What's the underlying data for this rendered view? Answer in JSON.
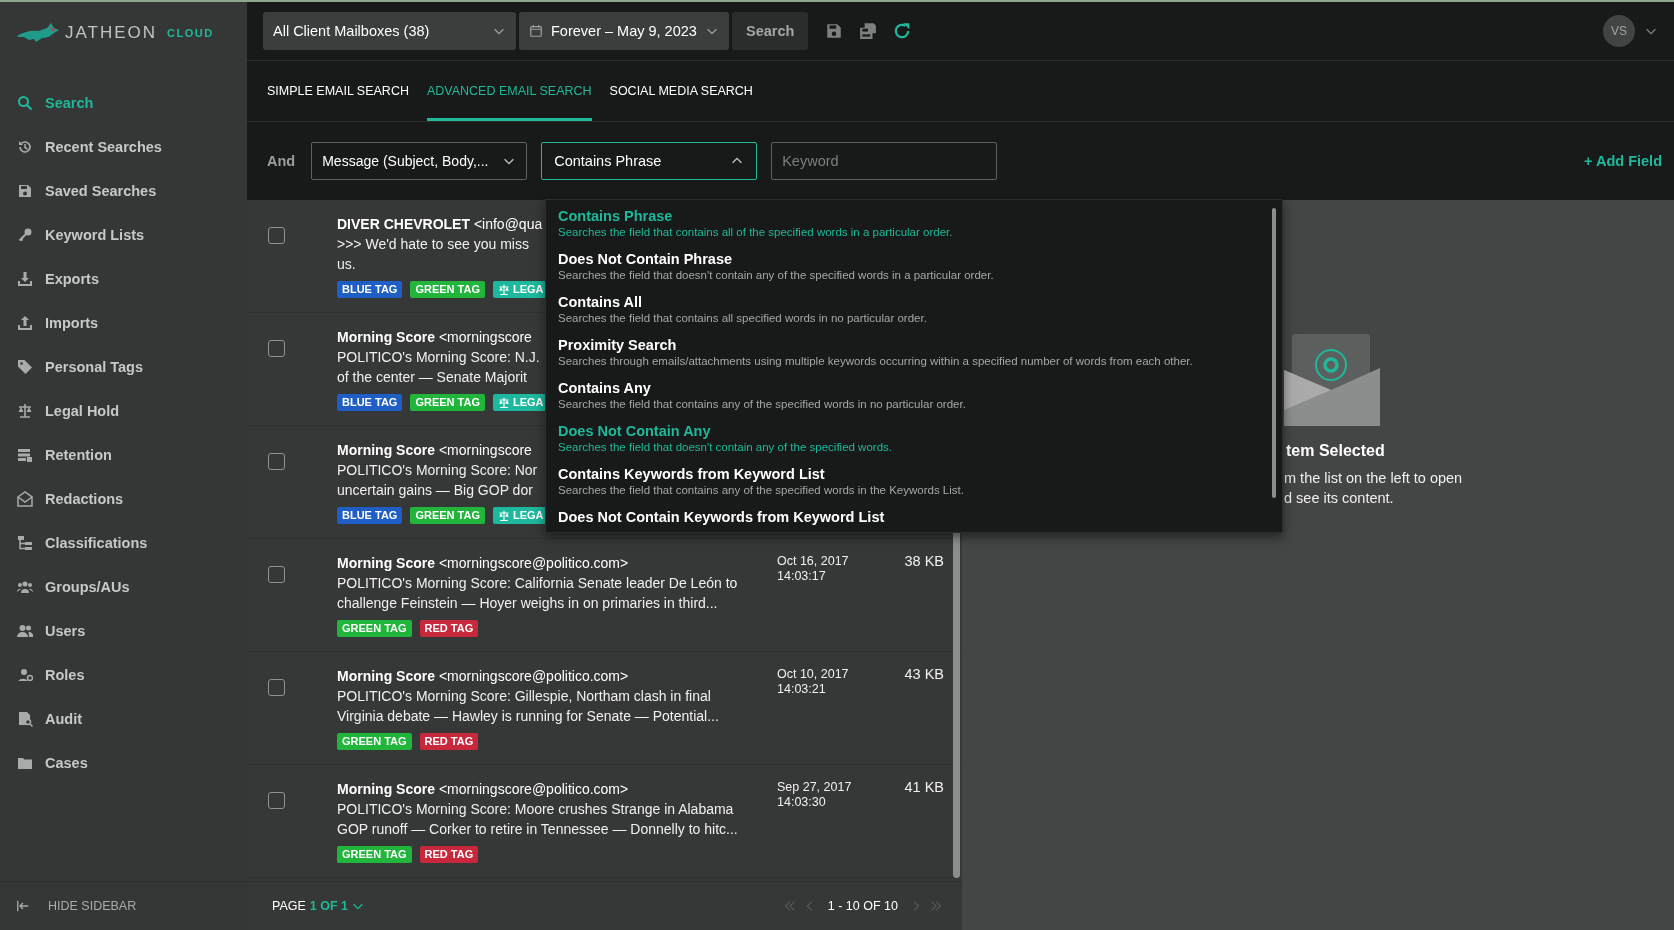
{
  "brand": {
    "name": "JATHEON",
    "suffix": "CLOUD"
  },
  "sidebar": {
    "items": [
      {
        "label": "Search",
        "selected": true
      },
      {
        "label": "Recent Searches",
        "selected": false
      },
      {
        "label": "Saved Searches",
        "selected": false
      },
      {
        "label": "Keyword Lists",
        "selected": false
      },
      {
        "label": "Exports",
        "selected": false
      },
      {
        "label": "Imports",
        "selected": false
      },
      {
        "label": "Personal Tags",
        "selected": false
      },
      {
        "label": "Legal Hold",
        "selected": false
      },
      {
        "label": "Retention",
        "selected": false
      },
      {
        "label": "Redactions",
        "selected": false
      },
      {
        "label": "Classifications",
        "selected": false
      },
      {
        "label": "Groups/AUs",
        "selected": false
      },
      {
        "label": "Users",
        "selected": false
      },
      {
        "label": "Roles",
        "selected": false
      },
      {
        "label": "Audit",
        "selected": false
      },
      {
        "label": "Cases",
        "selected": false
      }
    ],
    "hide_label": "HIDE SIDEBAR"
  },
  "topbar": {
    "mailbox_select": "All Client Mailboxes (38)",
    "date_range": "Forever – May 9, 2023",
    "search_button": "Search",
    "avatar": "VS"
  },
  "tabs": [
    {
      "label": "SIMPLE EMAIL SEARCH",
      "selected": false
    },
    {
      "label": "ADVANCED EMAIL SEARCH",
      "selected": true
    },
    {
      "label": "SOCIAL MEDIA SEARCH",
      "selected": false
    }
  ],
  "query": {
    "operator": "And",
    "field": "Message (Subject, Body,...",
    "condition": "Contains Phrase",
    "condition_expanded": true,
    "keyword_placeholder": "Keyword",
    "add_field": "+ Add Field"
  },
  "condition_menu": [
    {
      "title": "Contains Phrase",
      "description": "Searches the field that contains all of the specified words in a particular order.",
      "highlighted": true
    },
    {
      "title": "Does Not Contain Phrase",
      "description": "Searches the field that doesn't contain any of the specified words in a particular order.",
      "highlighted": false
    },
    {
      "title": "Contains All",
      "description": "Searches the field that contains all specified words in no particular order.",
      "highlighted": false
    },
    {
      "title": "Proximity Search",
      "description": "Searches through emails/attachments using multiple keywords occurring within a specified number of words from each other.",
      "highlighted": false
    },
    {
      "title": "Contains Any",
      "description": "Searches the field that contains any of the specified words in no particular order.",
      "highlighted": false
    },
    {
      "title": "Does Not Contain Any",
      "description": "Searches the field that doesn't contain any of the specified words.",
      "highlighted": true
    },
    {
      "title": "Contains Keywords from Keyword List",
      "description": "Searches the field that contains any of the specified words in the Keywords List.",
      "highlighted": false
    },
    {
      "title": "Does Not Contain Keywords from Keyword List",
      "highlighted": false
    }
  ],
  "emails": [
    {
      "sender": "DIVER CHEVROLET",
      "address": "<info@qua",
      "lines": [
        ">>> We'd hate to see you miss",
        "us."
      ],
      "checked": false,
      "tags": [
        {
          "label": "BLUE TAG",
          "color": "#1f5ec4",
          "kind": "plain"
        },
        {
          "label": "GREEN TAG",
          "color": "#21b53c",
          "kind": "plain"
        },
        {
          "label": "LEGA",
          "color": "#1db89d",
          "kind": "legal"
        }
      ]
    },
    {
      "sender": "Morning Score",
      "address": "<morningscore",
      "lines": [
        "POLITICO's Morning Score: N.J.",
        "of the center — Senate Majorit"
      ],
      "checked": false,
      "tags": [
        {
          "label": "BLUE TAG",
          "color": "#1f5ec4",
          "kind": "plain"
        },
        {
          "label": "GREEN TAG",
          "color": "#21b53c",
          "kind": "plain"
        },
        {
          "label": "LEGA",
          "color": "#1db89d",
          "kind": "legal"
        }
      ]
    },
    {
      "sender": "Morning Score",
      "address": "<morningscore",
      "lines": [
        "POLITICO's Morning Score: Nor",
        "uncertain gains — Big GOP dor"
      ],
      "checked": false,
      "tags": [
        {
          "label": "BLUE TAG",
          "color": "#1f5ec4",
          "kind": "plain"
        },
        {
          "label": "GREEN TAG",
          "color": "#21b53c",
          "kind": "plain"
        },
        {
          "label": "LEGA",
          "color": "#1db89d",
          "kind": "legal"
        }
      ]
    },
    {
      "sender": "Morning Score",
      "address": "<morningscore@politico.com>",
      "lines": [
        "POLITICO's Morning Score: California Senate leader De León to",
        "challenge Feinstein — Hoyer weighs in on primaries in third..."
      ],
      "checked": false,
      "date": "Oct 16, 2017",
      "time": "14:03:17",
      "size": "38 KB",
      "tags": [
        {
          "label": "GREEN TAG",
          "color": "#21b53c",
          "kind": "plain"
        },
        {
          "label": "RED TAG",
          "color": "#c8283c",
          "kind": "plain"
        }
      ]
    },
    {
      "sender": "Morning Score",
      "address": "<morningscore@politico.com>",
      "lines": [
        "POLITICO's Morning Score: Gillespie, Northam clash in final",
        "Virginia debate — Hawley is running for Senate — Potential..."
      ],
      "checked": false,
      "date": "Oct 10, 2017",
      "time": "14:03:21",
      "size": "43 KB",
      "tags": [
        {
          "label": "GREEN TAG",
          "color": "#21b53c",
          "kind": "plain"
        },
        {
          "label": "RED TAG",
          "color": "#c8283c",
          "kind": "plain"
        }
      ]
    },
    {
      "sender": "Morning Score",
      "address": "<morningscore@politico.com>",
      "lines": [
        "POLITICO's Morning Score: Moore crushes Strange in Alabama",
        "GOP runoff — Corker to retire in Tennessee — Donnelly to hitc..."
      ],
      "checked": false,
      "date": "Sep 27, 2017",
      "time": "14:03:30",
      "size": "41 KB",
      "tags": [
        {
          "label": "GREEN TAG",
          "color": "#21b53c",
          "kind": "plain"
        },
        {
          "label": "RED TAG",
          "color": "#c8283c",
          "kind": "plain"
        }
      ]
    }
  ],
  "pager": {
    "page_label": "PAGE",
    "page_value": "1 OF 1",
    "range": "1 - 10 OF 10"
  },
  "preview_pane": {
    "title": "tem Selected",
    "lines": [
      "m the list on the left to open",
      "d see its content."
    ]
  }
}
